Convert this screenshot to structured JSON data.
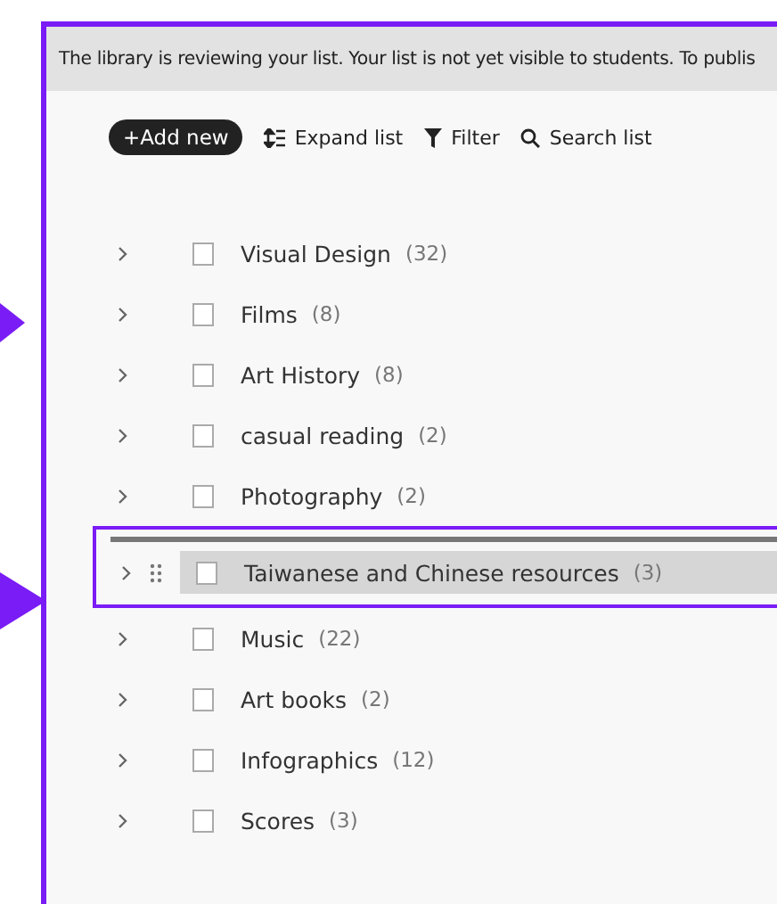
{
  "notice": "The library is reviewing your list. Your list is not yet visible to students. To publis",
  "toolbar": [
    {
      "kind": "add",
      "label": "+Add new"
    },
    {
      "kind": "expand",
      "label": "Expand list"
    },
    {
      "kind": "filter",
      "label": "Filter"
    },
    {
      "kind": "search",
      "label": "Search list"
    }
  ],
  "rows": [
    {
      "kind": "row",
      "label": "Visual Design",
      "count": "(32)",
      "checked": false
    },
    {
      "kind": "row",
      "label": "Films",
      "count": "(8)",
      "checked": false
    },
    {
      "kind": "row",
      "label": "Art History",
      "count": "(8)",
      "checked": false
    },
    {
      "kind": "row",
      "label": "casual reading",
      "count": "(2)",
      "checked": false
    },
    {
      "kind": "row",
      "label": "Photography",
      "count": "(2)",
      "checked": false
    },
    {
      "kind": "dragged",
      "label": "Taiwanese and Chinese resources",
      "count": "(3)",
      "checked": false
    },
    {
      "kind": "row",
      "label": "Music",
      "count": "(22)",
      "checked": false
    },
    {
      "kind": "row",
      "label": "Art books",
      "count": "(2)",
      "checked": false
    },
    {
      "kind": "row",
      "label": "Infographics",
      "count": "(12)",
      "checked": false
    },
    {
      "kind": "row",
      "label": "Scores",
      "count": "(3)",
      "checked": false
    }
  ]
}
